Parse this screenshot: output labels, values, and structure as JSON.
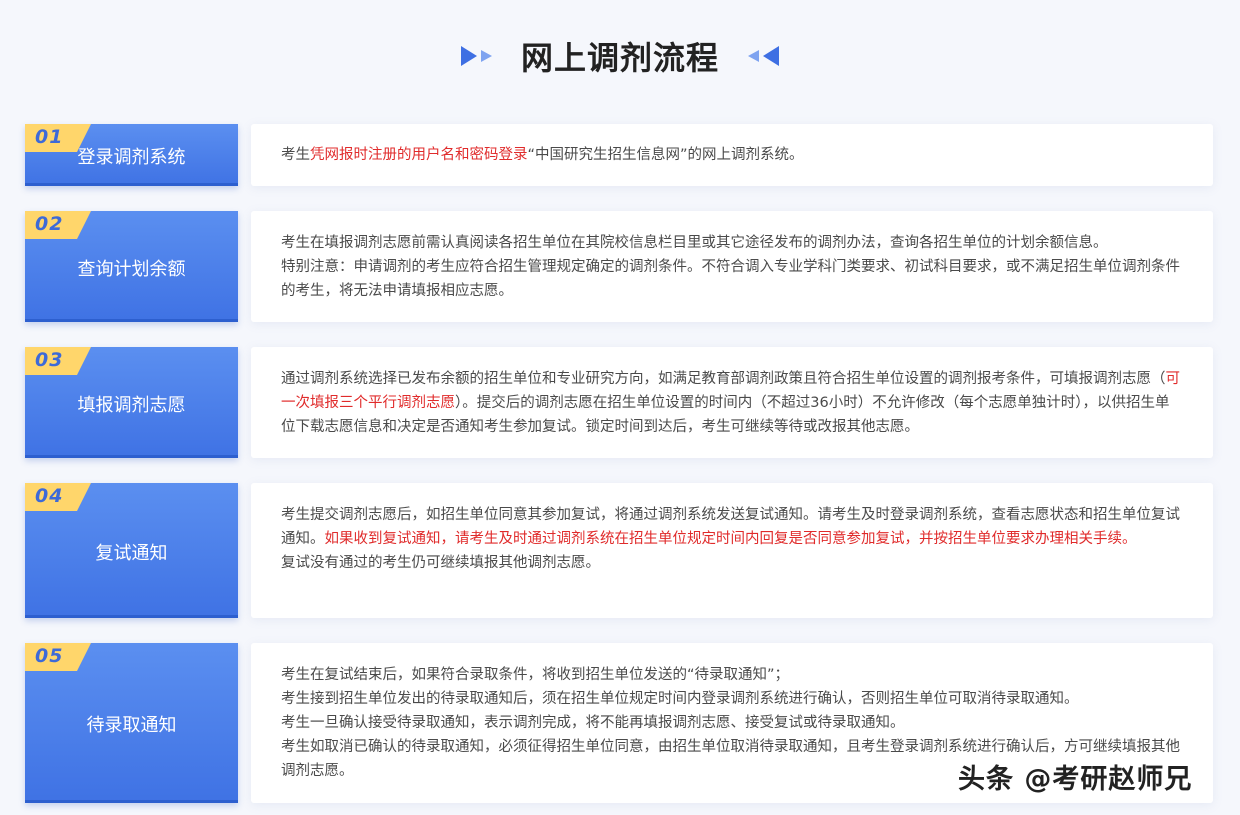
{
  "header": {
    "title": "网上调剂流程"
  },
  "steps": [
    {
      "num": "01",
      "title": "登录调剂系统",
      "p1_a": "考生",
      "p1_b": "凭网报时注册的用户名和密码登录",
      "p1_c": "“中国研究生招生信息网”的网上调剂系统。"
    },
    {
      "num": "02",
      "title": "查询计划余额",
      "p1": "考生在填报调剂志愿前需认真阅读各招生单位在其院校信息栏目里或其它途径发布的调剂办法，查询各招生单位的计划余额信息。",
      "p2_red": "特别注意：申请调剂的考生应符合招生管理规定确定的调剂条件。不符合调入专业学科门类要求、初试科目要求，或不满足招生单位调剂条件的考生，将无法申请填报相应志愿。"
    },
    {
      "num": "03",
      "title": "填报调剂志愿",
      "p1_a": "通过调剂系统选择已发布余额的招生单位和专业研究方向，如满足教育部调剂政策且符合招生单位设置的调剂报考条件，可填报调剂志愿（",
      "p1_b": "可一次填报三个平行调剂志愿",
      "p1_c": "）。提交后的调剂志愿在招生单位设置的时间内（不超过36小时）不允许修改（每个志愿单独计时），以供招生单位下载志愿信息和决定是否通知考生参加复试。锁定时间到达后，考生可继续等待或改报其他志愿。"
    },
    {
      "num": "04",
      "title": "复试通知",
      "p1_a": "考生提交调剂志愿后，如招生单位同意其参加复试，将通过调剂系统发送复试通知。请考生及时登录调剂系统，查看志愿状态和招生单位复试通知。",
      "p1_b": "如果收到复试通知，请考生及时通过调剂系统在招生单位规定时间内回复是否同意参加复试，并按招生单位要求办理相关手续。",
      "p2": "复试没有通过的考生仍可继续填报其他调剂志愿。"
    },
    {
      "num": "05",
      "title": "待录取通知",
      "p1": "考生在复试结束后，如果符合录取条件，将收到招生单位发送的“待录取通知”；",
      "p2": "考生接到招生单位发出的待录取通知后，须在招生单位规定时间内登录调剂系统进行确认，否则招生单位可取消待录取通知。",
      "p3_red": "考生一旦确认接受待录取通知，表示调剂完成，将不能再填报调剂志愿、接受复试或待录取通知。",
      "p4": "考生如取消已确认的待录取通知，必须征得招生单位同意，由招生单位取消待录取通知，且考生登录调剂系统进行确认后，方可继续填报其他调剂志愿。"
    }
  ],
  "watermark": "头条 @考研赵师兄",
  "colors": {
    "accent": "#4a7ee8",
    "badge_tab": "#ffd66b",
    "highlight": "#e02b2b"
  }
}
